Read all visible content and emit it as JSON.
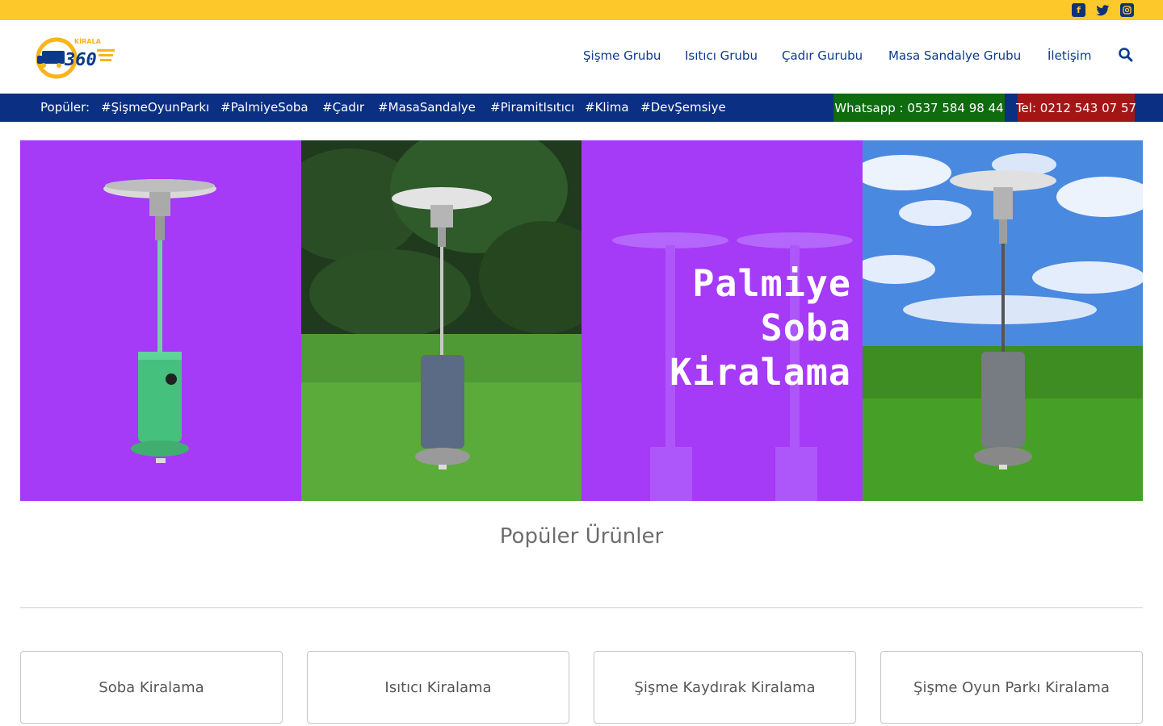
{
  "social": {
    "icons": [
      "facebook-icon",
      "twitter-icon",
      "instagram-icon"
    ]
  },
  "logo": {
    "small_text": "KİRALA",
    "number": "360"
  },
  "nav": {
    "items": [
      {
        "label": "Şişme Grubu"
      },
      {
        "label": "Isıtıcı Grubu"
      },
      {
        "label": "Çadır Gurubu"
      },
      {
        "label": "Masa Sandalye Grubu"
      },
      {
        "label": "İletişim"
      }
    ],
    "search_icon": "search-icon"
  },
  "tags": {
    "label": "Popüler:",
    "items": [
      "#ŞişmeOyunParkı",
      "#PalmiyeSoba",
      "#Çadır",
      "#MasaSandalye",
      "#PiramitIsıtıcı",
      "#Klima",
      "#DevŞemsiye"
    ]
  },
  "contact": {
    "whatsapp": "Whatsapp : 0537 584 98 44",
    "tel": "Tel: 0212 543 07 57"
  },
  "banner": {
    "title_line1": "Palmiye Soba",
    "title_line2": "Kiralama"
  },
  "section": {
    "title": "Popüler Ürünler"
  },
  "cards": [
    {
      "label": "Soba Kiralama"
    },
    {
      "label": "Isıtıcı Kiralama"
    },
    {
      "label": "Şişme Kaydırak Kiralama"
    },
    {
      "label": "Şişme Oyun Parkı Kiralama"
    }
  ],
  "colors": {
    "topbar": "#fcc82a",
    "nav_text": "#0b3a8c",
    "bluebar": "#0b2f82",
    "whatsapp": "#0e6b0e",
    "tel": "#a41616",
    "purple": "#a53af7"
  }
}
